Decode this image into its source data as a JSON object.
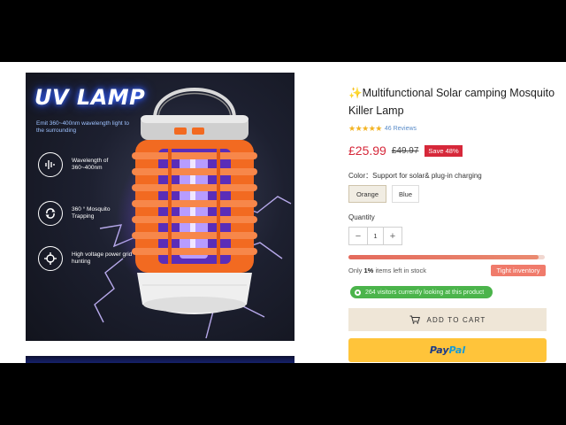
{
  "product": {
    "title": "✨Multifunctional Solar camping Mosquito Killer Lamp",
    "rating_stars": "★★★★★",
    "reviews": "46 Reviews",
    "price": "£25.99",
    "old_price": "£49.97",
    "save_badge": "Save 48%"
  },
  "image": {
    "headline": "UV LAMP",
    "subtitle": "Emit 360~400nm wavelength light to the surrounding",
    "features": [
      {
        "text": "Wavelength of 360~400nm",
        "icon": "waveform-icon"
      },
      {
        "text": "360 ° Mosquito Trapping",
        "icon": "rotate-icon"
      },
      {
        "text": "High voltage power grid hunting",
        "icon": "target-icon"
      }
    ]
  },
  "color": {
    "label": "Color：Support for solar& plug-in charging",
    "options": [
      "Orange",
      "Blue"
    ],
    "selected": "Orange"
  },
  "quantity": {
    "label": "Quantity",
    "value": "1",
    "minus": "−",
    "plus": "+"
  },
  "stock": {
    "prefix": "Only ",
    "count": "1%",
    "suffix": " items left in stock",
    "badge": "Tight inventory",
    "bar_fill_fraction": 0.97
  },
  "visitors": {
    "text": "264 visitors currently looking at this product"
  },
  "buttons": {
    "add_to_cart": "ADD TO CART",
    "paypal_1": "Pay",
    "paypal_2": "Pal"
  },
  "colors": {
    "accent_red": "#d6283a",
    "lamp_orange": "#f26a21",
    "paypal_yellow": "#ffc43a",
    "visitors_green": "#4bb44b"
  }
}
